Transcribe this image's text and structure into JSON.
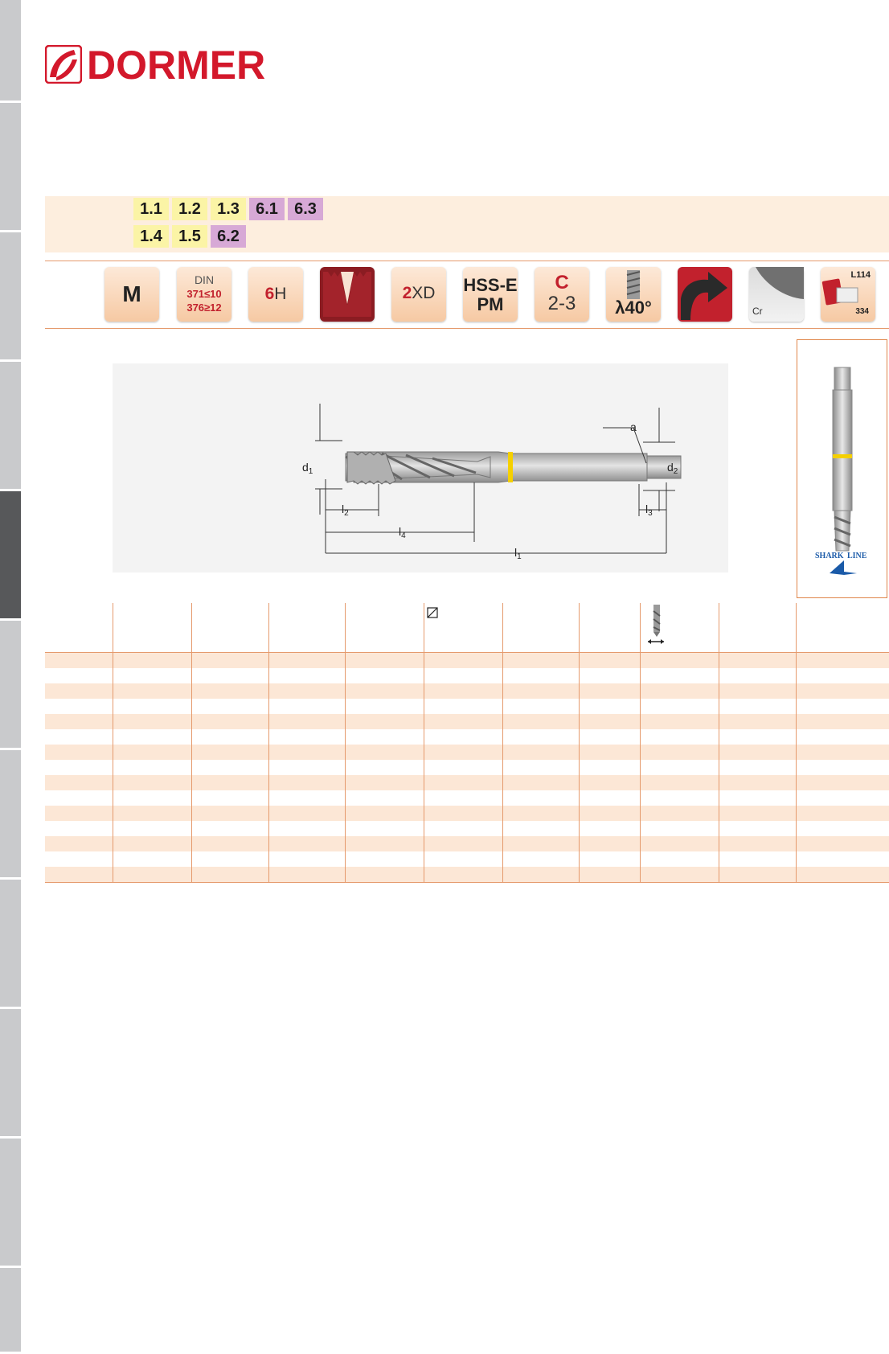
{
  "brand": {
    "logo_text": "DORMER",
    "brand_color": "#d3182b"
  },
  "materials": {
    "row1": [
      {
        "label": "1.1",
        "color": "#fbf4a6"
      },
      {
        "label": "1.2",
        "color": "#fbf4a6"
      },
      {
        "label": "1.3",
        "color": "#fbf4a6"
      },
      {
        "label": "6.1",
        "color": "#d7a9d6"
      },
      {
        "label": "6.3",
        "color": "#d7a9d6"
      }
    ],
    "row2": [
      {
        "label": "1.4",
        "color": "#fbf4a6"
      },
      {
        "label": "1.5",
        "color": "#fbf4a6"
      },
      {
        "label": "6.2",
        "color": "#d7a9d6"
      }
    ]
  },
  "icons": {
    "thread_form": "M",
    "din_label": "DIN",
    "din_371": "371≤10",
    "din_376": "376≥12",
    "tolerance_num": "6",
    "tolerance_letter": "H",
    "depth_num": "2",
    "depth_letter": "XD",
    "material_line1": "HSS-E",
    "material_line2": "PM",
    "chamfer_letter": "C",
    "chamfer_value": "2-3",
    "helix_angle": "λ40°",
    "coating_label": "Cr",
    "catalogue_top": "L114",
    "catalogue_bottom": "334",
    "icon_names": [
      "thread-form-icon",
      "din-standard-icon",
      "tolerance-icon",
      "thread-profile-icon",
      "depth-icon",
      "material-icon",
      "chamfer-icon",
      "helix-angle-icon",
      "rotation-icon",
      "coating-icon",
      "catalogue-icon"
    ]
  },
  "drawing": {
    "labels": {
      "a": "a",
      "d1": "d",
      "d1_sub": "1",
      "d2": "d",
      "d2_sub": "2",
      "l1": "l",
      "l1_sub": "1",
      "l2": "l",
      "l2_sub": "2",
      "l3": "l",
      "l3_sub": "3",
      "l4": "l",
      "l4_sub": "4"
    },
    "ring_color": "#f5d000"
  },
  "side_image": {
    "logo_left": "SHARK",
    "logo_right": "LINE"
  },
  "table": {
    "column_count": 11,
    "row_count": 15,
    "header_icons": [
      "square-icon",
      "drill-icon"
    ]
  }
}
